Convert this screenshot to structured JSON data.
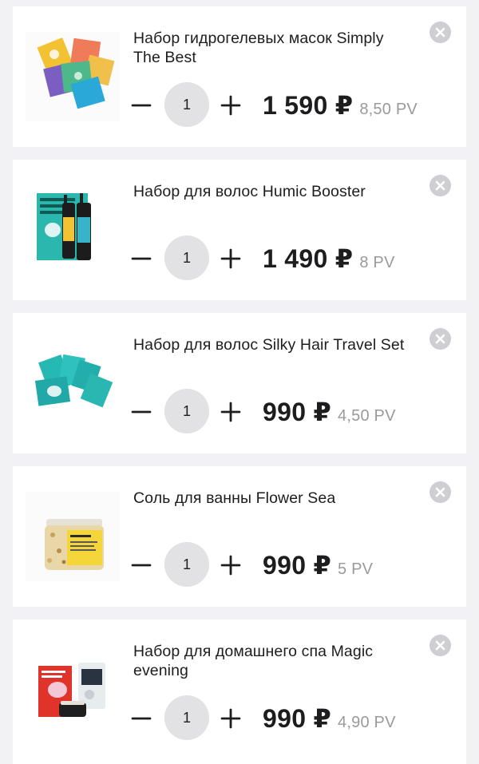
{
  "currency_symbol": "₽",
  "colors": {
    "background": "#f2f2f4",
    "card": "#ffffff",
    "text": "#1d1d1f",
    "muted": "#9a9a9e",
    "qty_circle": "#e2e2e4",
    "close_button": "#cfcfd3"
  },
  "icons": {
    "remove": "close-icon",
    "decrease": "minus-icon",
    "increase": "plus-icon"
  },
  "cart": {
    "items": [
      {
        "title": "Набор гидрогелевых масок Simply The Best",
        "quantity": "1",
        "price": "1 590 ₽",
        "pv": "8,50 PV",
        "image": "product-image-hydrogel-masks"
      },
      {
        "title": "Набор для волос Humic Booster",
        "quantity": "1",
        "price": "1 490 ₽",
        "pv": "8 PV",
        "image": "product-image-hair-set-bottles"
      },
      {
        "title": "Набор для волос Silky Hair Travel Set",
        "quantity": "1",
        "price": "990 ₽",
        "pv": "4,50 PV",
        "image": "product-image-travel-sachets"
      },
      {
        "title": "Соль для ванны Flower Sea",
        "quantity": "1",
        "price": "990 ₽",
        "pv": "5 PV",
        "image": "product-image-bath-salt-jar"
      },
      {
        "title": "Набор для домашнего спа Magic evening",
        "quantity": "1",
        "price": "990 ₽",
        "pv": "4,90 PV",
        "image": "product-image-spa-set"
      }
    ]
  }
}
